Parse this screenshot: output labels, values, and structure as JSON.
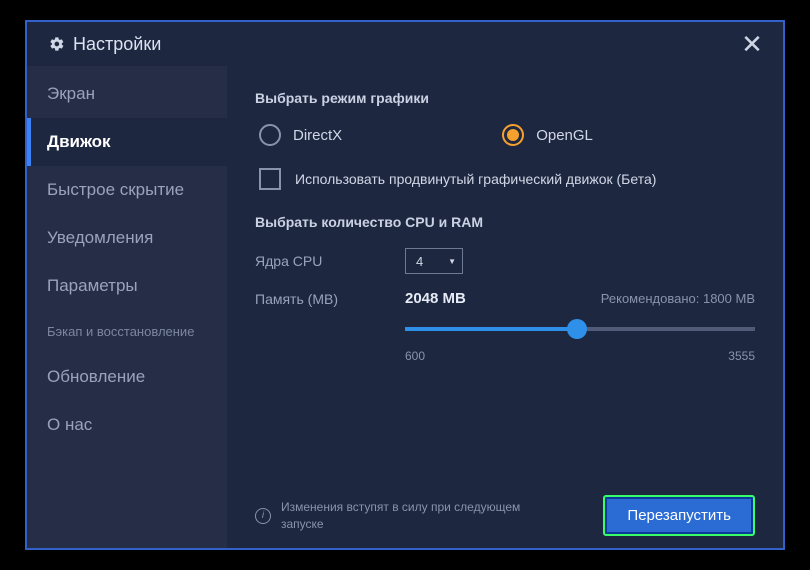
{
  "window": {
    "title": "Настройки"
  },
  "sidebar": {
    "items": [
      {
        "label": "Экран"
      },
      {
        "label": "Движок"
      },
      {
        "label": "Быстрое скрытие"
      },
      {
        "label": "Уведомления"
      },
      {
        "label": "Параметры"
      },
      {
        "label": "Бэкап и восстановление"
      },
      {
        "label": "Обновление"
      },
      {
        "label": "О нас"
      }
    ]
  },
  "engine": {
    "graphics_mode_title": "Выбрать режим графики",
    "radio_directx": "DirectX",
    "radio_opengl": "OpenGL",
    "advanced_checkbox": "Использовать продвинутый графический движок (Бета)",
    "cpu_ram_title": "Выбрать количество CPU и RAM",
    "cpu_label": "Ядра CPU",
    "cpu_value": "4",
    "mem_label": "Память (MB)",
    "mem_value": "2048 MB",
    "mem_recommended": "Рекомендовано: 1800 MB",
    "slider_min": "600",
    "slider_max": "3555"
  },
  "footer": {
    "note": "Изменения вступят в силу при следующем запуске",
    "restart_label": "Перезапустить"
  }
}
